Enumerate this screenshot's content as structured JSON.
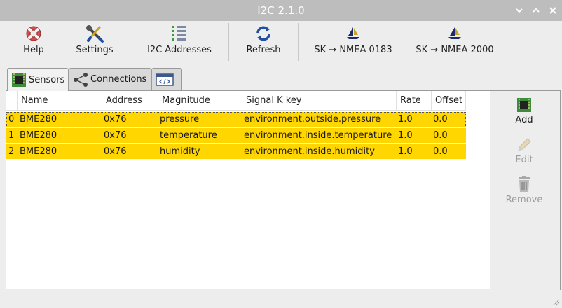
{
  "window": {
    "title": "I2C 2.1.0"
  },
  "toolbar": {
    "help": "Help",
    "settings": "Settings",
    "i2c_addresses": "I2C Addresses",
    "refresh": "Refresh",
    "sk_nmea0183": "SK → NMEA 0183",
    "sk_nmea2000": "SK → NMEA 2000"
  },
  "tabs": {
    "sensors": "Sensors",
    "connections": "Connections"
  },
  "table": {
    "columns": [
      "Name",
      "Address",
      "Magnitude",
      "Signal K key",
      "Rate",
      "Offset"
    ],
    "rows": [
      {
        "index": "0",
        "name": "BME280",
        "address": "0x76",
        "magnitude": "pressure",
        "sk_key": "environment.outside.pressure",
        "rate": "1.0",
        "offset": "0.0"
      },
      {
        "index": "1",
        "name": "BME280",
        "address": "0x76",
        "magnitude": "temperature",
        "sk_key": "environment.inside.temperature",
        "rate": "1.0",
        "offset": "0.0"
      },
      {
        "index": "2",
        "name": "BME280",
        "address": "0x76",
        "magnitude": "humidity",
        "sk_key": "environment.inside.humidity",
        "rate": "1.0",
        "offset": "0.0"
      }
    ]
  },
  "actions": {
    "add": "Add",
    "edit": "Edit",
    "remove": "Remove"
  },
  "colors": {
    "row_highlight": "#ffd600",
    "titlebar": "#bdbdbd"
  },
  "icons": {
    "help": "lifebuoy-icon",
    "settings": "wrench-screwdriver-icon",
    "i2c_addresses": "checklist-icon",
    "refresh": "refresh-icon",
    "sk": "signalk-sailboat-icon",
    "sensors_tab": "chip-icon",
    "connections_tab": "share-icon",
    "code_tab": "code-window-icon",
    "add": "chip-icon",
    "edit": "pencil-icon",
    "remove": "trash-icon"
  }
}
